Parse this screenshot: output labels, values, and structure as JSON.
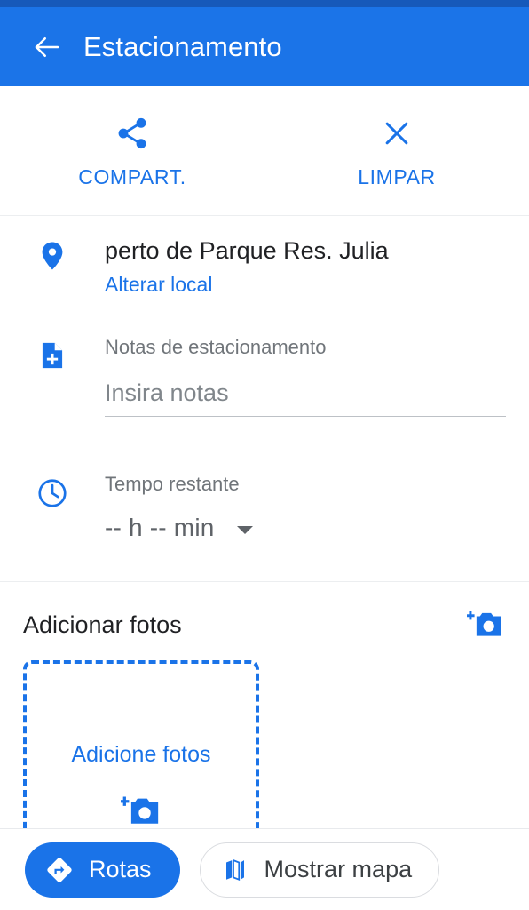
{
  "colors": {
    "status_bar": "#1659ba",
    "app_bar": "#1b74e8",
    "accent_blue": "#1a73e8",
    "text_primary": "#202124",
    "text_secondary": "#70757a",
    "divider": "#eceef0"
  },
  "app_bar": {
    "title": "Estacionamento",
    "back_icon": "arrow-back-icon"
  },
  "actions": [
    {
      "id": "share",
      "label": "COMPART.",
      "icon": "share-icon"
    },
    {
      "id": "clear",
      "label": "LIMPAR",
      "icon": "close-icon"
    }
  ],
  "details": {
    "location": {
      "icon": "map-pin-icon",
      "title": "perto de Parque Res. Julia",
      "link_label": "Alterar local"
    },
    "notes": {
      "icon": "note-add-icon",
      "label": "Notas de estacionamento",
      "value": "",
      "placeholder": "Insira notas"
    },
    "time": {
      "icon": "clock-icon",
      "label": "Tempo restante",
      "value": "-- h -- min",
      "caret_icon": "chevron-down-icon"
    }
  },
  "photos": {
    "title": "Adicionar fotos",
    "add_icon": "add-a-photo-icon",
    "dropzone": {
      "label": "Adicione fotos",
      "icon": "add-a-photo-icon"
    }
  },
  "bottom_bar": {
    "directions": {
      "label": "Rotas",
      "icon": "directions-icon"
    },
    "show_map": {
      "label": "Mostrar mapa",
      "icon": "map-icon"
    }
  }
}
